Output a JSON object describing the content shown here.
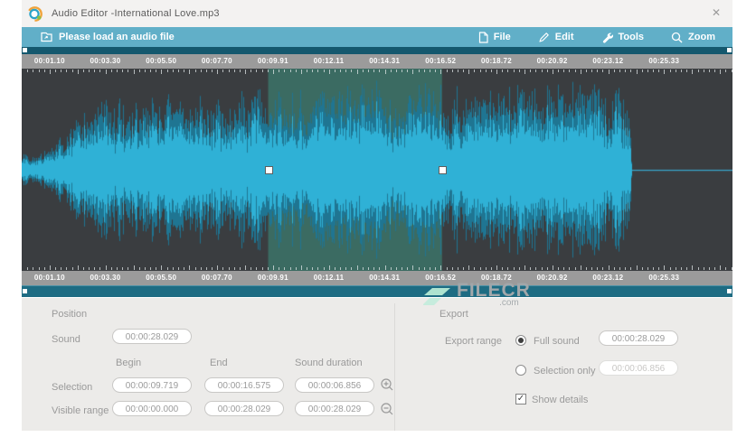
{
  "window": {
    "title": "Audio Editor  -International Love.mp3",
    "close_glyph": "✕"
  },
  "toolbar": {
    "load_button_label": "Please load an audio file",
    "menus": [
      {
        "label": "File"
      },
      {
        "label": "Edit"
      },
      {
        "label": "Tools"
      },
      {
        "label": "Zoom"
      }
    ]
  },
  "timeline": {
    "duration_seconds": 28.029,
    "audio_end_seconds": 24.05,
    "selection": {
      "begin_seconds": 9.719,
      "end_seconds": 16.575
    },
    "minor_tick_seconds": 0.2203,
    "ruler_labels": [
      {
        "t": 1.1,
        "text": "00:01.10"
      },
      {
        "t": 3.3,
        "text": "00:03.30"
      },
      {
        "t": 5.5,
        "text": "00:05.50"
      },
      {
        "t": 7.7,
        "text": "00:07.70"
      },
      {
        "t": 9.91,
        "text": "00:09.91"
      },
      {
        "t": 12.11,
        "text": "00:12.11"
      },
      {
        "t": 14.31,
        "text": "00:14.31"
      },
      {
        "t": 16.52,
        "text": "00:16.52"
      },
      {
        "t": 18.72,
        "text": "00:18.72"
      },
      {
        "t": 20.92,
        "text": "00:20.92"
      },
      {
        "t": 23.12,
        "text": "00:23.12"
      },
      {
        "t": 25.33,
        "text": "00:25.33"
      }
    ],
    "envelope": [
      [
        0,
        0.16
      ],
      [
        0.6,
        0.2
      ],
      [
        1.1,
        0.33
      ],
      [
        1.7,
        0.52
      ],
      [
        2.3,
        0.75
      ],
      [
        3.2,
        0.85
      ],
      [
        4.5,
        0.95
      ],
      [
        6,
        0.85
      ],
      [
        7.5,
        0.9
      ],
      [
        9,
        0.82
      ],
      [
        10,
        0.92
      ],
      [
        11,
        0.85
      ],
      [
        12,
        0.95
      ],
      [
        13,
        0.88
      ],
      [
        14,
        0.95
      ],
      [
        15,
        0.85
      ],
      [
        16,
        0.93
      ],
      [
        17,
        0.88
      ],
      [
        18,
        0.95
      ],
      [
        19,
        0.87
      ],
      [
        20,
        0.93
      ],
      [
        21,
        0.9
      ],
      [
        22,
        0.95
      ],
      [
        23,
        0.88
      ],
      [
        23.7,
        0.92
      ],
      [
        24,
        0.6
      ],
      [
        24.05,
        0
      ]
    ],
    "colors": {
      "waveform_background": "#3a3d40",
      "selection_background": "#3b6b62",
      "wave_outer": "#1f7592",
      "wave_inner": "#2fb1d6",
      "center_line": "#39a9cf",
      "ruler_background": "#9b9b9b",
      "ruler_text": "#fdfdfd",
      "scrollbar": "#1e6c83",
      "top_strip": "#14586e"
    }
  },
  "position_panel": {
    "title": "Position",
    "sound_label": "Sound",
    "sound_value": "00:00:28.029",
    "columns": [
      "Begin",
      "End",
      "Sound duration"
    ],
    "rows": [
      {
        "label": "Selection",
        "begin": "00:00:09.719",
        "end": "00:00:16.575",
        "duration": "00:00:06.856"
      },
      {
        "label": "Visible range",
        "begin": "00:00:00.000",
        "end": "00:00:28.029",
        "duration": "00:00:28.029"
      }
    ]
  },
  "export_panel": {
    "title": "Export",
    "range_label": "Export range",
    "options": [
      {
        "label": "Full sound",
        "value": "00:00:28.029",
        "selected": true
      },
      {
        "label": "Selection only",
        "value": "00:00:06.856",
        "selected": false
      }
    ],
    "show_details_label": "Show details",
    "show_details_checked": true
  },
  "watermark": {
    "text": "FILECR",
    "suffix": ".com"
  }
}
